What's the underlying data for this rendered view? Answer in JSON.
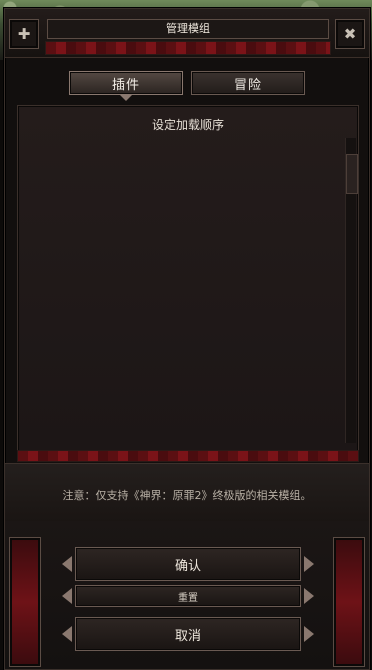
{
  "window": {
    "title": "管理模组"
  },
  "tabs": [
    {
      "label": "插件"
    },
    {
      "label": "冒险"
    }
  ],
  "content": {
    "title": "设定加载顺序"
  },
  "notice": {
    "text": "注意：仅支持《神界：原罪2》终极版的相关模组。"
  },
  "buttons": {
    "confirm": "确认",
    "reset": "重置",
    "cancel": "取消"
  }
}
